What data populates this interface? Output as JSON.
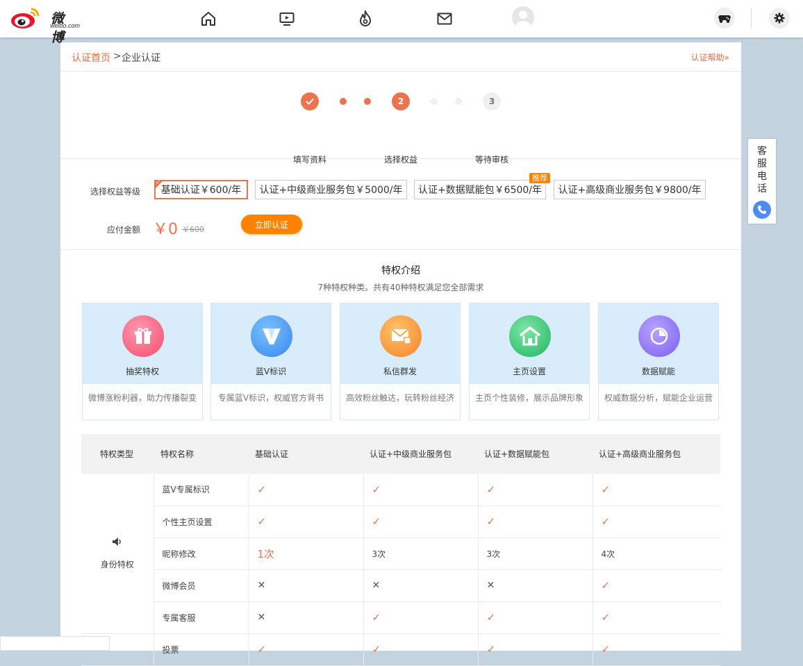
{
  "logo": {
    "text": "微博",
    "sub": "weibo.com"
  },
  "breadcrumb": {
    "home": "认证首页",
    "sep": ">",
    "current": "企业认证",
    "help": "认证帮助»"
  },
  "steps": [
    {
      "num": "",
      "label": "填写资料",
      "done": true
    },
    {
      "num": "2",
      "label": "选择权益",
      "done": true
    },
    {
      "num": "3",
      "label": "等待审核",
      "done": false
    }
  ],
  "choose": {
    "label": "选择权益等级",
    "tiers": [
      "基础认证￥600/年",
      "认证+中级商业服务包￥5000/年",
      "认证+数据赋能包￥6500/年",
      "认证+高级商业服务包￥9800/年"
    ],
    "recommend_badge": "推荐",
    "pay_label": "应付金额",
    "amount": "￥0",
    "original": "￥600",
    "submit": "立即认证"
  },
  "privileges": {
    "title": "特权介绍",
    "subtitle": "7种特权种类。共有40种特权满足您全部需求",
    "cards": [
      {
        "name": "抽奖特权",
        "desc": "微博涨粉利器，助力传播裂变",
        "icon": "gift-icon",
        "color": "#f45a77"
      },
      {
        "name": "蓝V标识",
        "desc": "专属蓝V标识，权威官方背书",
        "icon": "verified-v-icon",
        "color": "#3d93f3"
      },
      {
        "name": "私信群发",
        "desc": "高效粉丝触达，玩转粉丝经济",
        "icon": "mail-icon",
        "color": "#fb8d2f"
      },
      {
        "name": "主页设置",
        "desc": "主页个性装修，展示品牌形象",
        "icon": "home-icon",
        "color": "#2fc26d"
      },
      {
        "name": "数据赋能",
        "desc": "权威数据分析，赋能企业运营",
        "icon": "pie-chart-icon",
        "color": "#8a6ff2"
      }
    ]
  },
  "table": {
    "headers": [
      "特权类型",
      "特权名称",
      "基础认证",
      "认证+中级商业服务包",
      "认证+数据赋能包",
      "认证+高级商业服务包"
    ],
    "group": "身份特权",
    "rows": [
      {
        "name": "蓝V专属标识",
        "cells": [
          "check",
          "check",
          "check",
          "check"
        ]
      },
      {
        "name": "个性主页设置",
        "cells": [
          "check",
          "check",
          "check",
          "check"
        ]
      },
      {
        "name": "昵称修改",
        "cells": [
          "1次",
          "3次",
          "3次",
          "4次"
        ]
      },
      {
        "name": "微博会员",
        "cells": [
          "cross",
          "cross",
          "cross",
          "check"
        ]
      },
      {
        "name": "专属客服",
        "cells": [
          "cross",
          "check",
          "check",
          "check"
        ]
      },
      {
        "name": "投票",
        "cells": [
          "check",
          "check",
          "check",
          "check"
        ]
      }
    ]
  },
  "side": {
    "text": "客服电话"
  }
}
